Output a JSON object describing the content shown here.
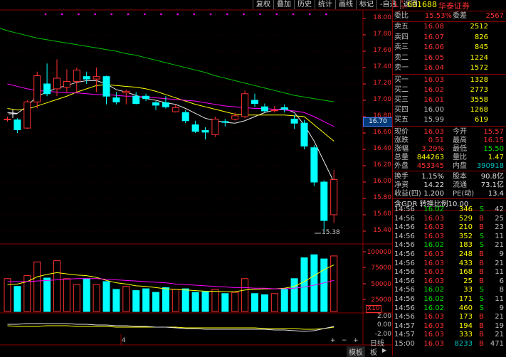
{
  "toolbar": {
    "items": [
      "复权",
      "叠加",
      "历史",
      "统计",
      "画线",
      "标记",
      "-自选",
      "返回"
    ]
  },
  "header": {
    "market": "L",
    "sub_top": "R",
    "sub_bot": "SH",
    "code": "601688",
    "name": "华泰证券"
  },
  "quote": {
    "wei": [
      {
        "label": "委比",
        "value": "15.53%",
        "label2": "委差",
        "value2": "2567"
      }
    ],
    "asks": [
      {
        "label": "卖五",
        "price": "16.08",
        "vol": "2512"
      },
      {
        "label": "卖四",
        "price": "16.07",
        "vol": "826"
      },
      {
        "label": "卖三",
        "price": "16.06",
        "vol": "845"
      },
      {
        "label": "卖二",
        "price": "16.05",
        "vol": "1224"
      },
      {
        "label": "卖一",
        "price": "16.04",
        "vol": "1572"
      }
    ],
    "bids": [
      {
        "label": "买一",
        "price": "16.03",
        "vol": "1328"
      },
      {
        "label": "买二",
        "price": "16.02",
        "vol": "2773"
      },
      {
        "label": "买三",
        "price": "16.01",
        "vol": "3558"
      },
      {
        "label": "买四",
        "price": "16.00",
        "vol": "1268"
      },
      {
        "label": "买五",
        "price": "15.99",
        "vol": "619"
      }
    ],
    "stats": [
      {
        "l1": "现价",
        "v1": "16.03",
        "l2": "今开",
        "v2": "15.57"
      },
      {
        "l1": "涨跌",
        "v1": "0.51",
        "l2": "最高",
        "v2": "16.15"
      },
      {
        "l1": "涨幅",
        "v1": "3.29%",
        "l2": "最低",
        "v2": "15.50"
      },
      {
        "l1": "总量",
        "v1": "844263",
        "l2": "量比",
        "v2": "1.47"
      },
      {
        "l1": "外盘",
        "v1": "453345",
        "l2": "内盘",
        "v2": "390918"
      }
    ],
    "stats2": [
      {
        "l1": "换手",
        "v1": "1.15%",
        "l2": "股本",
        "v2": "90.8亿"
      },
      {
        "l1": "净资",
        "v1": "14.22",
        "l2": "流通",
        "v2": "73.1亿"
      },
      {
        "l1": "收益(四)",
        "v1": "1.200",
        "l2": "PE(动)",
        "v2": "13.4"
      }
    ],
    "gdr": "含GDR 转换比例10.00"
  },
  "trades": [
    {
      "t": "14:56",
      "p": "16.02",
      "v": "346",
      "s": "S",
      "n": "42"
    },
    {
      "t": "14:56",
      "p": "16.03",
      "v": "529",
      "s": "B",
      "n": "25"
    },
    {
      "t": "14:56",
      "p": "16.03",
      "v": "210",
      "s": "B",
      "n": "23"
    },
    {
      "t": "14:56",
      "p": "16.03",
      "v": "352",
      "s": "S",
      "n": "11"
    },
    {
      "t": "14:56",
      "p": "16.02",
      "v": "183",
      "s": "S",
      "n": "21"
    },
    {
      "t": "14:56",
      "p": "16.03",
      "v": "248",
      "s": "B",
      "n": "9"
    },
    {
      "t": "14:56",
      "p": "16.03",
      "v": "433",
      "s": "B",
      "n": "21"
    },
    {
      "t": "14:56",
      "p": "16.03",
      "v": "168",
      "s": "B",
      "n": "11"
    },
    {
      "t": "14:56",
      "p": "16.03",
      "v": "25",
      "s": "B",
      "n": "6"
    },
    {
      "t": "14:56",
      "p": "16.02",
      "v": "33",
      "s": "S",
      "n": "8"
    },
    {
      "t": "14:56",
      "p": "16.02",
      "v": "171",
      "s": "S",
      "n": "11"
    },
    {
      "t": "14:56",
      "p": "16.02",
      "v": "460",
      "s": "S",
      "n": "9"
    },
    {
      "t": "14:56",
      "p": "16.03",
      "v": "173",
      "s": "B",
      "n": "21"
    },
    {
      "t": "14:57",
      "p": "16.03",
      "v": "194",
      "s": "B",
      "n": "19"
    },
    {
      "t": "14:57",
      "p": "16.03",
      "v": "333",
      "s": "B",
      "n": "21"
    },
    {
      "t": "15:00",
      "p": "16.03",
      "v": "8233",
      "s": "B",
      "n": "471"
    }
  ],
  "price_axis": [
    "18.00",
    "17.80",
    "17.60",
    "17.40",
    "17.20",
    "17.00",
    "16.80",
    "16.60",
    "16.40",
    "16.20",
    "16.00",
    "15.80",
    "15.60",
    "15.40"
  ],
  "last_price_tag": "16.70",
  "low_label": "15.38",
  "vol_axis": [
    "100000",
    "75000",
    "50000",
    "25000"
  ],
  "vol_unit": "X10",
  "macd_axis": [
    "2.00",
    "0.00",
    "-2.00"
  ],
  "bottom": {
    "period": "日线",
    "idx": "4",
    "tab1": "模板",
    "tab2": "板"
  },
  "chart_data": {
    "type": "candlestick",
    "candles": [
      {
        "o": 16.77,
        "c": 16.77,
        "h": 16.8,
        "l": 16.74
      },
      {
        "o": 16.76,
        "c": 16.64,
        "h": 16.78,
        "l": 16.6
      },
      {
        "o": 16.66,
        "c": 16.98,
        "h": 17.0,
        "l": 16.65
      },
      {
        "o": 16.98,
        "c": 17.3,
        "h": 17.35,
        "l": 16.9
      },
      {
        "o": 17.2,
        "c": 17.08,
        "h": 17.45,
        "l": 17.05
      },
      {
        "o": 17.14,
        "c": 17.27,
        "h": 17.5,
        "l": 17.05
      },
      {
        "o": 17.16,
        "c": 17.23,
        "h": 17.38,
        "l": 17.1
      },
      {
        "o": 17.23,
        "c": 17.37,
        "h": 17.4,
        "l": 17.1
      },
      {
        "o": 17.29,
        "c": 17.26,
        "h": 17.35,
        "l": 17.2
      },
      {
        "o": 17.26,
        "c": 17.29,
        "h": 17.4,
        "l": 17.1
      },
      {
        "o": 17.29,
        "c": 17.05,
        "h": 17.3,
        "l": 16.95
      },
      {
        "o": 17.03,
        "c": 16.98,
        "h": 17.1,
        "l": 16.95
      },
      {
        "o": 17.09,
        "c": 17.11,
        "h": 17.13,
        "l": 16.95
      },
      {
        "o": 17.05,
        "c": 16.96,
        "h": 17.1,
        "l": 16.95
      },
      {
        "o": 17.05,
        "c": 17.02,
        "h": 17.08,
        "l": 16.99
      },
      {
        "o": 16.97,
        "c": 16.94,
        "h": 16.99,
        "l": 16.88
      },
      {
        "o": 16.97,
        "c": 16.92,
        "h": 17.05,
        "l": 16.9
      },
      {
        "o": 16.86,
        "c": 16.91,
        "h": 16.95,
        "l": 16.85
      },
      {
        "o": 16.85,
        "c": 16.75,
        "h": 16.88,
        "l": 16.72
      },
      {
        "o": 16.7,
        "c": 16.62,
        "h": 16.75,
        "l": 16.6
      },
      {
        "o": 16.63,
        "c": 16.61,
        "h": 16.67,
        "l": 16.52
      },
      {
        "o": 16.58,
        "c": 16.77,
        "h": 16.8,
        "l": 16.55
      },
      {
        "o": 16.74,
        "c": 16.73,
        "h": 16.77,
        "l": 16.68
      },
      {
        "o": 16.77,
        "c": 16.81,
        "h": 16.85,
        "l": 16.75
      },
      {
        "o": 16.8,
        "c": 17.08,
        "h": 17.12,
        "l": 16.78
      },
      {
        "o": 17.0,
        "c": 16.96,
        "h": 17.08,
        "l": 16.92
      },
      {
        "o": 16.92,
        "c": 16.87,
        "h": 16.96,
        "l": 16.85
      },
      {
        "o": 16.88,
        "c": 16.88,
        "h": 16.93,
        "l": 16.85
      },
      {
        "o": 16.91,
        "c": 16.89,
        "h": 16.95,
        "l": 16.85
      },
      {
        "o": 16.77,
        "c": 16.72,
        "h": 16.82,
        "l": 16.65
      },
      {
        "o": 16.72,
        "c": 16.44,
        "h": 16.76,
        "l": 16.4
      },
      {
        "o": 16.42,
        "c": 16.0,
        "h": 16.45,
        "l": 15.95
      },
      {
        "o": 16.0,
        "c": 15.53,
        "h": 16.02,
        "l": 15.38
      },
      {
        "o": 15.6,
        "c": 16.03,
        "h": 16.15,
        "l": 15.5
      }
    ],
    "ma_lines": [
      {
        "name": "MA5",
        "color": "#e8e8e8",
        "values": [
          16.85,
          16.84,
          16.93,
          17.05,
          17.1,
          17.15,
          17.18,
          17.22,
          17.24,
          17.24,
          17.2,
          17.13,
          17.1,
          17.06,
          17.02,
          17.0,
          16.97,
          16.95,
          16.9,
          16.84,
          16.78,
          16.75,
          16.73,
          16.72,
          16.75,
          16.8,
          16.85,
          16.88,
          16.9,
          16.85,
          16.7,
          16.5,
          16.25,
          16.0
        ]
      },
      {
        "name": "MA10",
        "color": "#ffff00",
        "values": [
          16.9,
          16.88,
          16.89,
          16.93,
          16.97,
          17.01,
          17.05,
          17.1,
          17.14,
          17.18,
          17.19,
          17.18,
          17.17,
          17.16,
          17.14,
          17.11,
          17.07,
          17.03,
          16.99,
          16.95,
          16.92,
          16.89,
          16.86,
          16.83,
          16.82,
          16.82,
          16.82,
          16.82,
          16.82,
          16.81,
          16.8,
          16.7,
          16.6,
          16.5
        ]
      },
      {
        "name": "MA20",
        "color": "#ff00ff",
        "values": [
          17.2,
          17.17,
          17.14,
          17.12,
          17.11,
          17.1,
          17.09,
          17.09,
          17.08,
          17.07,
          17.07,
          17.06,
          17.05,
          17.05,
          17.04,
          17.03,
          17.02,
          17.01,
          17.0,
          16.99,
          16.97,
          16.95,
          16.93,
          16.92,
          16.91,
          16.9,
          16.9,
          16.89,
          16.88,
          16.87,
          16.85,
          16.8,
          16.74,
          16.68
        ]
      },
      {
        "name": "MA60",
        "color": "#00c000",
        "values": [
          17.85,
          17.82,
          17.79,
          17.76,
          17.74,
          17.72,
          17.7,
          17.68,
          17.66,
          17.64,
          17.62,
          17.6,
          17.57,
          17.55,
          17.52,
          17.49,
          17.46,
          17.43,
          17.4,
          17.37,
          17.34,
          17.3,
          17.27,
          17.24,
          17.21,
          17.18,
          17.15,
          17.12,
          17.09,
          17.06,
          17.04,
          17.02,
          17.0,
          16.98
        ]
      }
    ],
    "volumes": [
      55000,
      42000,
      60000,
      83000,
      56000,
      85000,
      55000,
      45000,
      55000,
      45000,
      50000,
      37000,
      42000,
      35000,
      38000,
      32000,
      40000,
      37000,
      38000,
      32000,
      33000,
      37000,
      30000,
      32000,
      55000,
      30000,
      28000,
      30000,
      38000,
      55000,
      90000,
      95000,
      88000,
      93000
    ],
    "vol_ma_a": [
      45000,
      46000,
      50000,
      58000,
      62000,
      65000,
      63000,
      61000,
      60000,
      57000,
      52000,
      48000,
      46000,
      43000,
      42000,
      40000,
      38000,
      37000,
      36000,
      35000,
      34000,
      34000,
      33000,
      33000,
      36000,
      37000,
      38000,
      38000,
      39000,
      42000,
      50000,
      60000,
      70000,
      78000
    ],
    "vol_ma_b": [
      50000,
      50000,
      50000,
      51000,
      52000,
      53000,
      54000,
      55000,
      55000,
      55000,
      54000,
      53000,
      52000,
      51000,
      50000,
      49000,
      48000,
      46000,
      45000,
      44000,
      43000,
      42000,
      41000,
      40000,
      40000,
      39000,
      39000,
      38000,
      38000,
      39000,
      41000,
      44000,
      48000,
      52000
    ]
  }
}
